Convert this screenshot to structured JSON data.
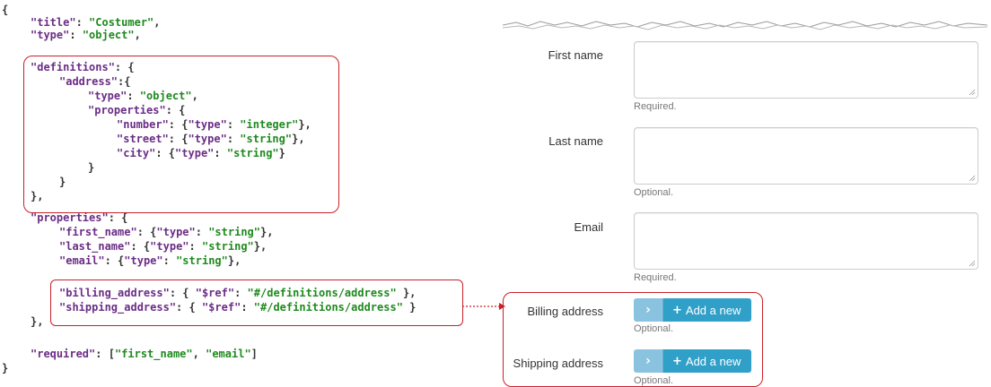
{
  "schema_code": {
    "open_brace": "{",
    "title_key": "\"title\"",
    "title_value": "\"Costumer\"",
    "type_key": "\"type\"",
    "type_value": "\"object\"",
    "definitions_key": "\"definitions\"",
    "address_key": "\"address\"",
    "address_type_key": "\"type\"",
    "address_type_value": "\"object\"",
    "address_props_key": "\"properties\"",
    "number_key": "\"number\"",
    "number_type_key": "\"type\"",
    "number_type_value": "\"integer\"",
    "street_key": "\"street\"",
    "street_type_key": "\"type\"",
    "street_type_value": "\"string\"",
    "city_key": "\"city\"",
    "city_type_key": "\"type\"",
    "city_type_value": "\"string\"",
    "properties_key": "\"properties\"",
    "first_name_key": "\"first_name\"",
    "first_name_type_key": "\"type\"",
    "first_name_type_value": "\"string\"",
    "last_name_key": "\"last_name\"",
    "last_name_type_key": "\"type\"",
    "last_name_type_value": "\"string\"",
    "email_key": "\"email\"",
    "email_type_key": "\"type\"",
    "email_type_value": "\"string\"",
    "billing_key": "\"billing_address\"",
    "billing_ref_key": "\"$ref\"",
    "billing_ref_value": "\"#/definitions/address\"",
    "shipping_key": "\"shipping_address\"",
    "shipping_ref_key": "\"$ref\"",
    "shipping_ref_value": "\"#/definitions/address\"",
    "required_key": "\"required\"",
    "required_first": "\"first_name\"",
    "required_second": "\"email\"",
    "close_brace": "}"
  },
  "form": {
    "first_name_label": "First name",
    "first_name_help": "Required.",
    "last_name_label": "Last name",
    "last_name_help": "Optional.",
    "email_label": "Email",
    "email_help": "Required.",
    "billing_label": "Billing address",
    "billing_button": "Add a new",
    "billing_help": "Optional.",
    "shipping_label": "Shipping address",
    "shipping_button": "Add a new",
    "shipping_help": "Optional."
  },
  "colors": {
    "key": "#6b2d86",
    "string": "#1f8a1f",
    "highlight": "#c8202a",
    "button": "#31a0c8",
    "button_chevron": "#8ac3df"
  },
  "icons": {
    "chevron": "chevron-right-icon",
    "plus": "plus-icon"
  }
}
